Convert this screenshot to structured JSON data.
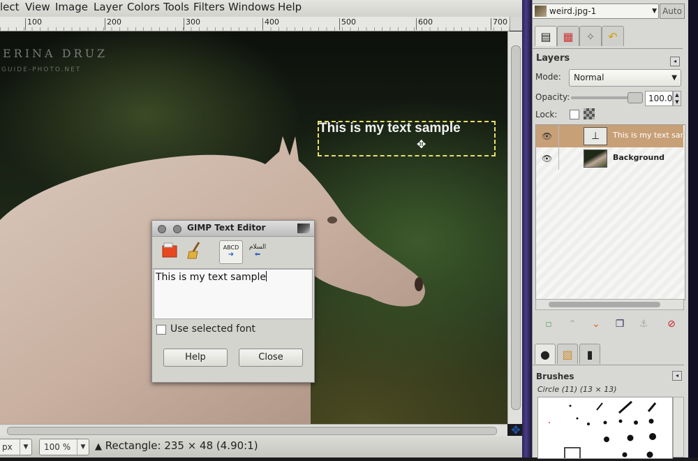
{
  "menubar": {
    "items": [
      "lect",
      "View",
      "Image",
      "Layer",
      "Colors",
      "Tools",
      "Filters",
      "Windows",
      "Help"
    ]
  },
  "ruler": {
    "labels": [
      "100",
      "200",
      "300",
      "400",
      "500",
      "600",
      "700"
    ]
  },
  "canvas": {
    "watermark_name": "ERINA DRUZ",
    "watermark_site": "GUIDE-PHOTO.NET",
    "text_layer": "This is my text sample"
  },
  "statusbar": {
    "unit": "px",
    "zoom": "100 %",
    "status": "Rectangle: 235 × 48  (4.90:1)"
  },
  "dock": {
    "image_select": "weird.jpg-1",
    "auto_button": "Auto",
    "layers": {
      "title": "Layers",
      "mode_label": "Mode:",
      "mode_value": "Normal",
      "opacity_label": "Opacity:",
      "opacity_value": "100.0",
      "opacity": 1.0,
      "lock_label": "Lock:",
      "items": [
        {
          "name": "This is my text sam",
          "selected": true
        },
        {
          "name": "Background",
          "selected": false
        }
      ]
    },
    "brushes": {
      "title": "Brushes",
      "selected": "Circle (11) (13 × 13)"
    }
  },
  "text_editor": {
    "title": "GIMP Text Editor",
    "toolbar": [
      "open-icon",
      "clear-icon",
      "ABCD",
      "rtl-icon"
    ],
    "content": "This is my text sample",
    "use_font_label": "Use selected font",
    "help_button": "Help",
    "close_button": "Close"
  },
  "colors": {
    "selection_dash": "#e8e06a",
    "selected_layer": "#c8a078"
  }
}
